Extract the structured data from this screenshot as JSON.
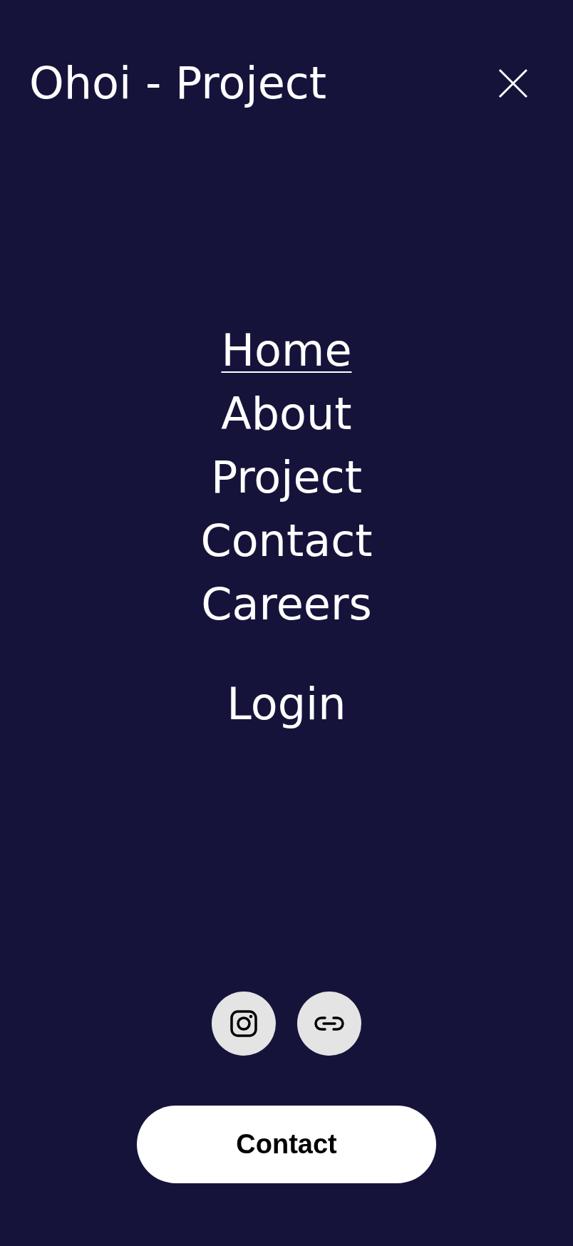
{
  "header": {
    "title": "Ohoi - Project"
  },
  "nav": [
    {
      "label": "Home",
      "selected": true
    },
    {
      "label": "About",
      "selected": false
    },
    {
      "label": "Project",
      "selected": false
    },
    {
      "label": "Contact",
      "selected": false
    },
    {
      "label": "Careers",
      "selected": false
    }
  ],
  "login": {
    "label": "Login"
  },
  "social": [
    {
      "kind": "instagram"
    },
    {
      "kind": "link"
    }
  ],
  "contact_button": {
    "label": "Contact"
  }
}
